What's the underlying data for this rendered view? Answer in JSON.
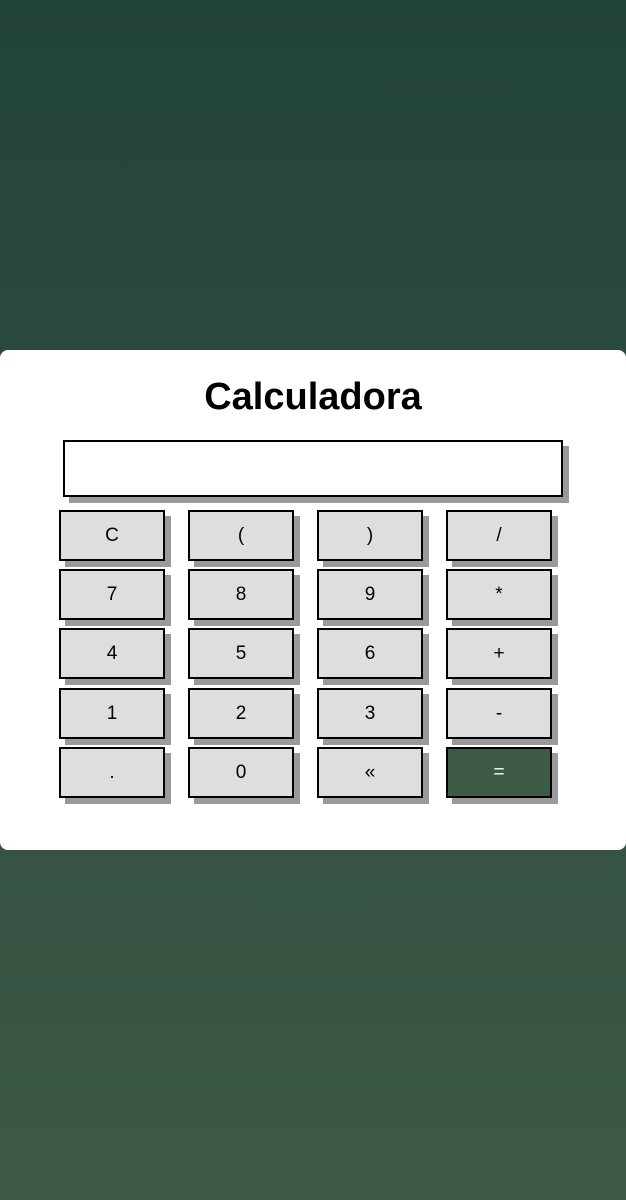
{
  "app": {
    "title": "Calculadora"
  },
  "display": {
    "value": ""
  },
  "keys": {
    "clear": "C",
    "open_paren": "(",
    "close_paren": ")",
    "divide": "/",
    "seven": "7",
    "eight": "8",
    "nine": "9",
    "multiply": "*",
    "four": "4",
    "five": "5",
    "six": "6",
    "plus": "+",
    "one": "1",
    "two": "2",
    "three": "3",
    "minus": "-",
    "decimal": ".",
    "zero": "0",
    "backspace": "«",
    "equals": "="
  },
  "colors": {
    "background_top": "#23443a",
    "background_bottom": "#3d5a47",
    "card": "#ffffff",
    "key": "#dedede",
    "equals_key": "#3d5a47",
    "key_shadow": "#9a9a9a"
  }
}
